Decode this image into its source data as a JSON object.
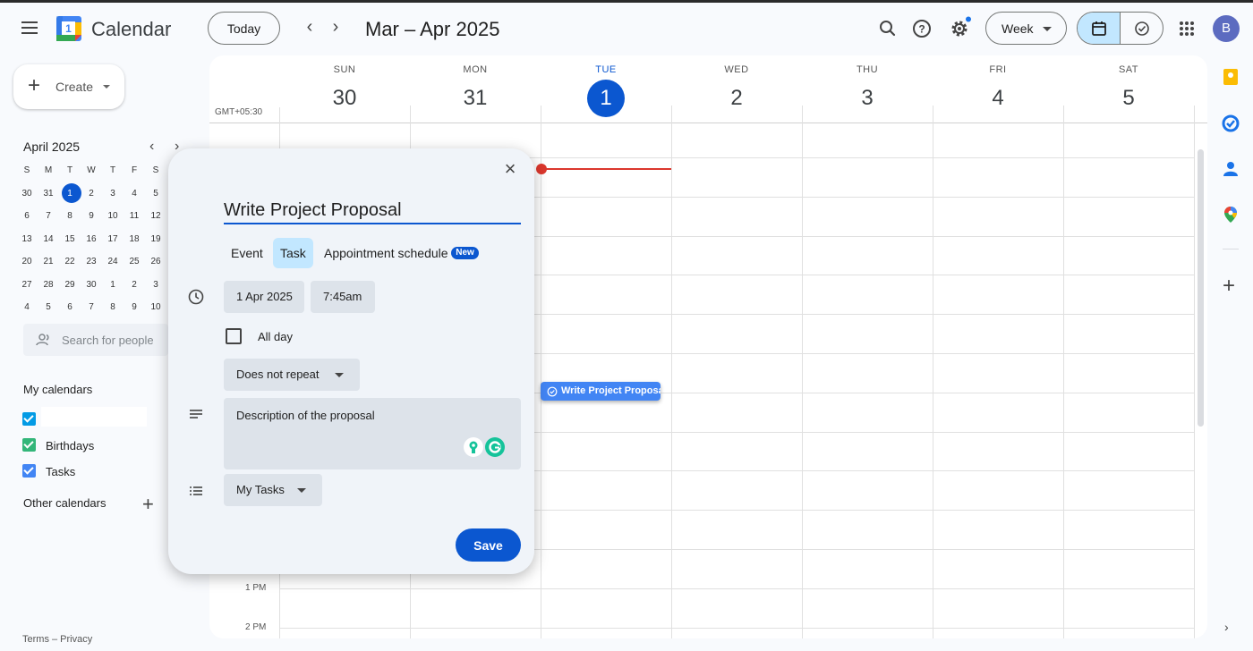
{
  "app": {
    "title": "Calendar",
    "logo_digit": "1"
  },
  "header": {
    "today_label": "Today",
    "range_title": "Mar – Apr 2025",
    "view_label": "Week",
    "avatar_initial": "B",
    "icons": [
      "search-icon",
      "help-icon",
      "settings-icon",
      "calendar-view-icon",
      "tasks-view-icon",
      "apps-grid-icon"
    ]
  },
  "sidebar": {
    "create_label": "Create",
    "mini_calendar": {
      "title": "April 2025",
      "weekdays": [
        "S",
        "M",
        "T",
        "W",
        "T",
        "F",
        "S"
      ],
      "weeks": [
        [
          "30",
          "31",
          "1",
          "2",
          "3",
          "4",
          "5"
        ],
        [
          "6",
          "7",
          "8",
          "9",
          "10",
          "11",
          "12"
        ],
        [
          "13",
          "14",
          "15",
          "16",
          "17",
          "18",
          "19"
        ],
        [
          "20",
          "21",
          "22",
          "23",
          "24",
          "25",
          "26"
        ],
        [
          "27",
          "28",
          "29",
          "30",
          "1",
          "2",
          "3"
        ],
        [
          "4",
          "5",
          "6",
          "7",
          "8",
          "9",
          "10"
        ]
      ],
      "today": "1"
    },
    "search_people_placeholder": "Search for people",
    "my_calendars_title": "My calendars",
    "my_calendars": [
      {
        "name": "",
        "color": "#039be5",
        "checked": true
      },
      {
        "name": "Birthdays",
        "color": "#33b679",
        "checked": true
      },
      {
        "name": "Tasks",
        "color": "#4285f4",
        "checked": true
      }
    ],
    "other_calendars_title": "Other calendars",
    "footer": "Terms – Privacy"
  },
  "week": {
    "timezone": "GMT+05:30",
    "days": [
      {
        "name": "SUN",
        "num": "30"
      },
      {
        "name": "MON",
        "num": "31"
      },
      {
        "name": "TUE",
        "num": "1",
        "today": true
      },
      {
        "name": "WED",
        "num": "2"
      },
      {
        "name": "THU",
        "num": "3"
      },
      {
        "name": "FRI",
        "num": "4"
      },
      {
        "name": "SAT",
        "num": "5"
      }
    ],
    "time_labels": [
      "1 PM",
      "2 PM"
    ],
    "task_chip": "Write Project Proposal"
  },
  "dialog": {
    "title_value": "Write Project Proposal",
    "tabs": [
      "Event",
      "Task",
      "Appointment schedule"
    ],
    "active_tab": "Task",
    "new_badge": "New",
    "date": "1 Apr 2025",
    "time": "7:45am",
    "all_day_label": "All day",
    "repeat": "Does not repeat",
    "description": "Description of the proposal",
    "task_list": "My Tasks",
    "save_label": "Save"
  },
  "colors": {
    "accent": "#0b57d0",
    "today_tab": "#c2e7ff",
    "now_line": "#db372d",
    "chip": "#4285f4"
  }
}
